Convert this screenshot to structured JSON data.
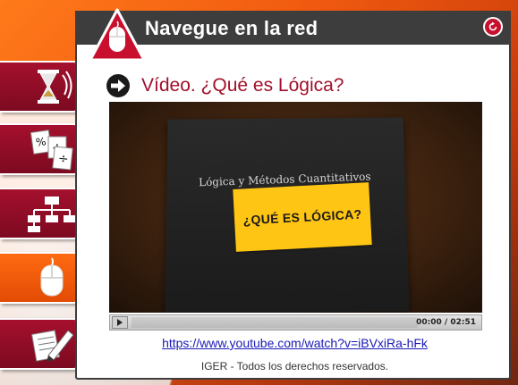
{
  "header": {
    "title": "Navegue en la red",
    "logo_icon": "mouse-icon",
    "refresh_icon": "refresh-icon"
  },
  "sidebar": {
    "items": [
      {
        "name": "hourglass-icon",
        "active": false
      },
      {
        "name": "math-operations-icon",
        "active": false
      },
      {
        "name": "org-chart-icon",
        "active": false
      },
      {
        "name": "mouse-icon",
        "active": true
      },
      {
        "name": "pencil-paper-icon",
        "active": false
      }
    ]
  },
  "section": {
    "heading": "Vídeo. ¿Qué es Lógica?",
    "arrow_icon": "arrow-right-circle-icon"
  },
  "video": {
    "book_title": "Lógica y Métodos Cuantitativos",
    "label_text": "¿QUÉ ES LÓGICA?",
    "time": "00:00 / 02:51",
    "progress": 0
  },
  "link": {
    "url": "https://www.youtube.com/watch?v=iBVxiRa-hFk"
  },
  "footer": {
    "copyright": "IGER - Todos los derechos reservados."
  },
  "colors": {
    "accent": "#a0102a",
    "orange": "#f05a10",
    "titlebar": "#3d3d3d",
    "label_yellow": "#ffc514"
  }
}
